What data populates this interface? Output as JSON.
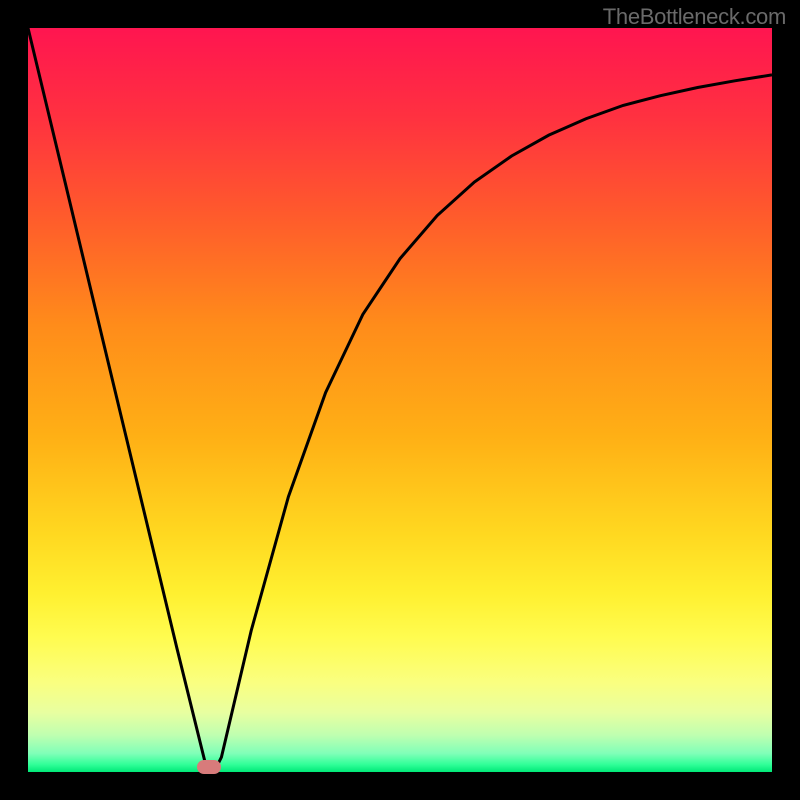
{
  "attribution": "TheBottleneck.com",
  "chart_data": {
    "type": "line",
    "title": "",
    "xlabel": "",
    "ylabel": "",
    "xlim": [
      0,
      100
    ],
    "ylim": [
      0,
      100
    ],
    "series": [
      {
        "name": "bottleneck-curve",
        "x": [
          0,
          5,
          10,
          15,
          20,
          24,
          25,
          26,
          30,
          35,
          40,
          45,
          50,
          55,
          60,
          65,
          70,
          75,
          80,
          85,
          90,
          95,
          100
        ],
        "values": [
          100,
          79.2,
          58.3,
          37.5,
          16.7,
          0.5,
          0,
          2,
          19,
          37,
          51,
          61.5,
          69,
          74.8,
          79.3,
          82.8,
          85.6,
          87.8,
          89.6,
          90.9,
          92,
          92.9,
          93.7
        ]
      }
    ],
    "marker": {
      "x": 24.3,
      "y": 0.7,
      "color": "#d87b7b"
    },
    "gradient_stops": [
      {
        "offset": 0,
        "color": "#ff1550"
      },
      {
        "offset": 12,
        "color": "#ff3140"
      },
      {
        "offset": 25,
        "color": "#ff5a2c"
      },
      {
        "offset": 40,
        "color": "#ff8c1a"
      },
      {
        "offset": 55,
        "color": "#ffb015"
      },
      {
        "offset": 68,
        "color": "#ffd820"
      },
      {
        "offset": 76,
        "color": "#fff030"
      },
      {
        "offset": 82,
        "color": "#fffc50"
      },
      {
        "offset": 88,
        "color": "#faff80"
      },
      {
        "offset": 92,
        "color": "#e8ffa0"
      },
      {
        "offset": 95,
        "color": "#c0ffb0"
      },
      {
        "offset": 97.5,
        "color": "#80ffb8"
      },
      {
        "offset": 99,
        "color": "#30ff98"
      },
      {
        "offset": 100,
        "color": "#00e878"
      }
    ]
  }
}
